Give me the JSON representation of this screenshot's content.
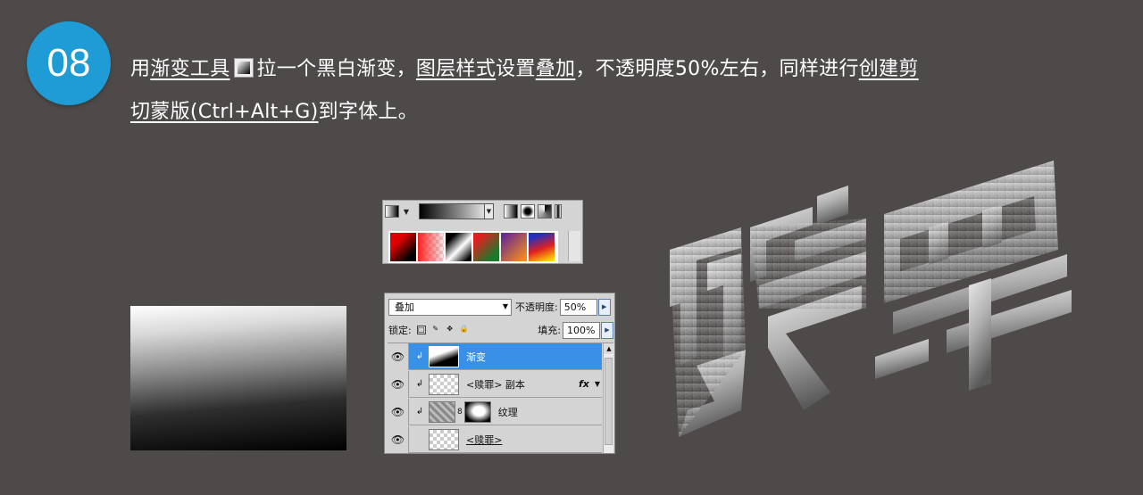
{
  "step": {
    "number": "08"
  },
  "instruction": {
    "line1": [
      {
        "text": "用",
        "u": false
      },
      {
        "text": "渐变工具",
        "u": true
      },
      {
        "text": "ICON",
        "u": false
      },
      {
        "text": "拉一个黑白渐变，",
        "u": false
      },
      {
        "text": "图层样式",
        "u": true
      },
      {
        "text": "设置",
        "u": false
      },
      {
        "text": "叠加",
        "u": true
      },
      {
        "text": "，不透明度50%左右，同样进行",
        "u": false
      },
      {
        "text": "创建剪",
        "u": true
      }
    ],
    "line2": [
      {
        "text": "切蒙版(Ctrl+Alt+G)",
        "u": true
      },
      {
        "text": "到字体上。",
        "u": false
      }
    ],
    "tool_icon": "gradient-tool-icon"
  },
  "gradient_bar": {
    "swatches": [
      "#e00000,#000",
      "checker-red",
      "#000,#fff",
      "#e02020,#1a7a2a",
      "#7a3aa0,#f08a20",
      "#2030c0,#e02020,#ffe000"
    ]
  },
  "layers_panel": {
    "blend_mode": "叠加",
    "opacity_label": "不透明度:",
    "opacity_value": "50%",
    "lock_label": "锁定:",
    "fill_label": "填充:",
    "fill_value": "100%",
    "layers": [
      {
        "name": "渐变",
        "selected": true,
        "clipped": true,
        "thumb": "gradient"
      },
      {
        "name": "<赎罪> 副本",
        "selected": false,
        "clipped": true,
        "thumb": "transparent",
        "fx": "fx"
      },
      {
        "name": "纹理",
        "selected": false,
        "clipped": true,
        "thumb": "texture",
        "mask": true
      },
      {
        "name": "<赎罪>",
        "selected": false,
        "clipped": false,
        "thumb": "transparent"
      }
    ]
  },
  "colors": {
    "background": "#4e4a49",
    "badge": "#1f9bd6",
    "selection": "#3a8fe6"
  }
}
